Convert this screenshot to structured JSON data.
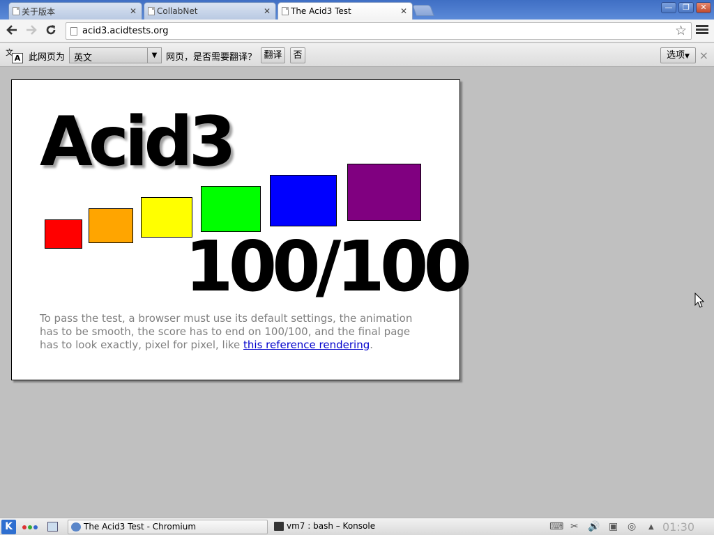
{
  "tabs": [
    {
      "label": "关于版本",
      "active": false
    },
    {
      "label": "CollabNet",
      "active": false
    },
    {
      "label": "The Acid3 Test",
      "active": true
    }
  ],
  "window_buttons": {
    "minimize": "—",
    "restore": "❐",
    "close": "✕"
  },
  "toolbar": {
    "back_icon": "back-arrow-icon",
    "forward_icon": "forward-arrow-icon",
    "reload_icon": "reload-icon",
    "url": "acid3.acidtests.org",
    "bookmark_icon": "star-icon",
    "menu_icon": "wrench-menu-icon"
  },
  "translate_bar": {
    "prefix": "此网页为",
    "language": "英文",
    "question": "网页，是否需要翻译？",
    "translate_button": "翻译",
    "no_button": "否",
    "options_button": "选项",
    "close": "×"
  },
  "page": {
    "title": "Acid3",
    "score": "100/100",
    "note_text": "To pass the test, a browser must use its default settings, the animation has to be smooth, the score has to end on 100/100, and the final page has to look exactly, pixel for pixel, like ",
    "link_text": "this reference rendering",
    "note_end": ".",
    "box_colors": [
      "#ff0000",
      "#ffa500",
      "#ffff00",
      "#00ff00",
      "#0000ff",
      "#800080"
    ]
  },
  "taskbar": {
    "start_label": "K",
    "tasks": [
      {
        "label": "The Acid3 Test - Chromium"
      },
      {
        "label": "vm7 : bash – Konsole"
      }
    ],
    "clock": "01:30"
  }
}
